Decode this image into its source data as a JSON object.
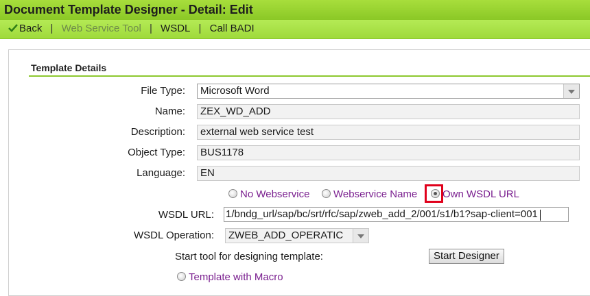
{
  "window": {
    "title": "Document Template Designer - Detail: Edit"
  },
  "toolbar": {
    "back_label": "Back",
    "web_service_tool_label": "Web Service Tool",
    "wsdl_label": "WSDL",
    "call_badi_label": "Call BADI",
    "separator": "|"
  },
  "section": {
    "title": "Template Details"
  },
  "form": {
    "file_type": {
      "label": "File Type:",
      "value": "Microsoft Word"
    },
    "name": {
      "label": "Name:",
      "value": "ZEX_WD_ADD"
    },
    "description": {
      "label": "Description:",
      "value": "external web service test"
    },
    "object_type": {
      "label": "Object Type:",
      "value": "BUS1178"
    },
    "language": {
      "label": "Language:",
      "value": "EN"
    },
    "webservice_options": [
      {
        "label": "No Webservice",
        "checked": false
      },
      {
        "label": "Webservice Name",
        "checked": false
      },
      {
        "label": "Own WSDL URL",
        "checked": true
      }
    ],
    "wsdl_url": {
      "label": "WSDL URL:",
      "value": "1/bndg_url/sap/bc/srt/rfc/sap/zweb_add_2/001/s1/b1?sap-client=001"
    },
    "wsdl_operation": {
      "label": "WSDL Operation:",
      "value": "ZWEB_ADD_OPERATIC"
    },
    "start_tool": {
      "label": "Start tool for designing template:",
      "button_label": "Start Designer"
    },
    "template_macro": {
      "label": "Template with Macro",
      "checked": false
    }
  },
  "colors": {
    "titlebar": "#8bc826",
    "toolbar": "#9fda3b",
    "radio_text": "#7a1f8f",
    "highlight": "#e0001b"
  }
}
